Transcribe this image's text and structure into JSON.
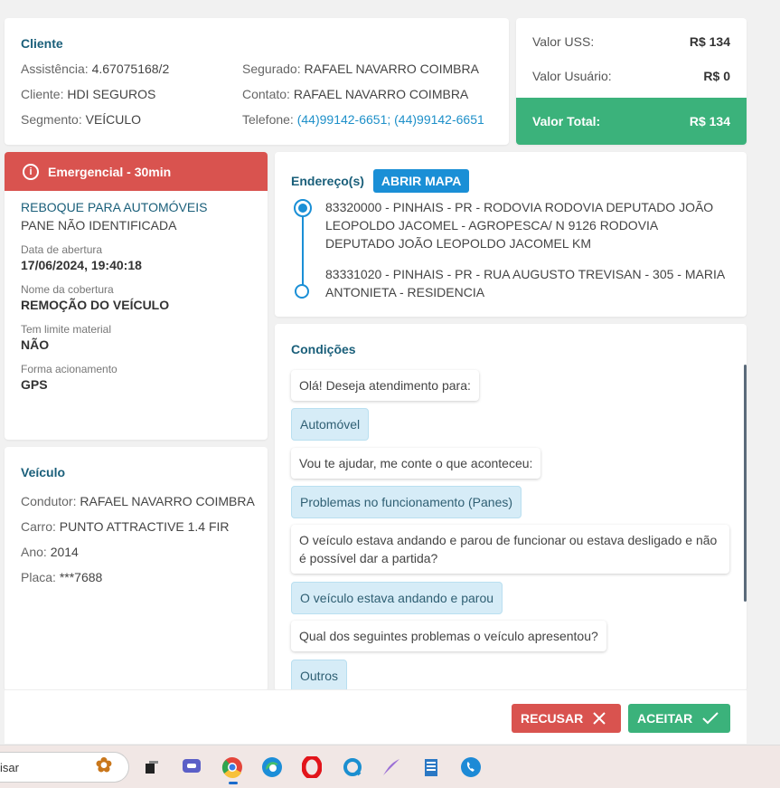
{
  "cliente": {
    "title": "Cliente",
    "assistencia_label": "Assistência:",
    "assistencia": "4.67075168/2",
    "cliente_label": "Cliente:",
    "cliente": "HDI SEGUROS",
    "segmento_label": "Segmento:",
    "segmento": "VEÍCULO",
    "segurado_label": "Segurado:",
    "segurado": "RAFAEL NAVARRO COIMBRA",
    "contato_label": "Contato:",
    "contato": "RAFAEL NAVARRO COIMBRA",
    "telefone_label": "Telefone:",
    "telefone": "(44)99142-6651; (44)99142-6651"
  },
  "valores": {
    "uss_label": "Valor USS:",
    "uss": "R$ 134",
    "usuario_label": "Valor Usuário:",
    "usuario": "R$ 0",
    "total_label": "Valor Total:",
    "total": "R$ 134",
    "total_color": "#3bb27b"
  },
  "servico": {
    "banner": "Emergencial - 30min",
    "banner_color": "#d9534f",
    "service_name": "REBOQUE PARA AUTOMÓVEIS",
    "problem": "PANE NÃO IDENTIFICADA",
    "data_label": "Data de abertura",
    "data": "17/06/2024, 19:40:18",
    "cobertura_label": "Nome da cobertura",
    "cobertura": "REMOÇÃO DO VEÍCULO",
    "limite_label": "Tem limite material",
    "limite": "NÃO",
    "acionamento_label": "Forma acionamento",
    "acionamento": "GPS"
  },
  "veiculo": {
    "title": "Veículo",
    "condutor_label": "Condutor:",
    "condutor": "RAFAEL NAVARRO COIMBRA",
    "carro_label": "Carro:",
    "carro": "PUNTO ATTRACTIVE 1.4 FIR",
    "ano_label": "Ano:",
    "ano": "2014",
    "placa_label": "Placa:",
    "placa": "***7688"
  },
  "endereco": {
    "title": "Endereço(s)",
    "map_button": "ABRIR MAPA",
    "origem": "83320000 - PINHAIS - PR - RODOVIA RODOVIA DEPUTADO JOÃO LEOPOLDO JACOMEL - AGROPESCA/ N 9126 RODOVIA DEPUTADO JOÃO LEOPOLDO JACOMEL KM",
    "destino": "83331020 - PINHAIS - PR - RUA AUGUSTO TREVISAN - 305 - MARIA ANTONIETA - RESIDENCIA"
  },
  "condicoes": {
    "title": "Condições",
    "messages": [
      {
        "type": "question",
        "text": "Olá! Deseja atendimento para:"
      },
      {
        "type": "answer",
        "text": "Automóvel"
      },
      {
        "type": "question",
        "text": "Vou te ajudar, me conte o que aconteceu:"
      },
      {
        "type": "answer",
        "text": "Problemas no funcionamento (Panes)"
      },
      {
        "type": "question",
        "text": "O veículo estava andando e parou de funcionar ou estava desligado e não é possível dar a partida?"
      },
      {
        "type": "answer",
        "text": "O veículo estava andando e parou"
      },
      {
        "type": "question",
        "text": "Qual dos seguintes problemas o veículo apresentou?"
      },
      {
        "type": "answer",
        "text": "Outros"
      }
    ]
  },
  "footer": {
    "recusar": "RECUSAR",
    "aceitar": "ACEITAR"
  },
  "taskbar": {
    "search_text": "isar",
    "icons": [
      "butterfly-icon",
      "task-view-icon",
      "chat-icon",
      "chrome-icon",
      "edge-icon",
      "opera-icon",
      "app-q-icon",
      "feather-icon",
      "notepad-icon",
      "phone-app-icon"
    ]
  }
}
